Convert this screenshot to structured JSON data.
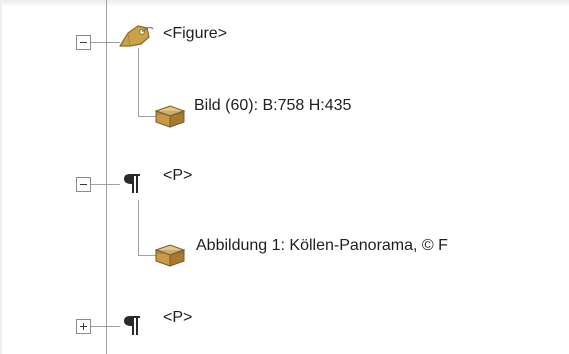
{
  "tree": {
    "nodes": [
      {
        "label": "<Figure>",
        "icon": "tag-icon",
        "expanded": true
      },
      {
        "label": "Bild (60): B:758 H:435",
        "icon": "container-icon"
      },
      {
        "label": "<P>",
        "icon": "paragraph-icon",
        "expanded": true
      },
      {
        "label": "Abbildung 1: Köllen-Panorama, © F",
        "icon": "container-icon"
      },
      {
        "label": "<P>",
        "icon": "paragraph-icon",
        "expanded": false
      }
    ]
  },
  "colors": {
    "tag": "#c9a24a",
    "container": "#b88a3c",
    "line": "#a0a0a0",
    "text": "#1f1f1f"
  }
}
